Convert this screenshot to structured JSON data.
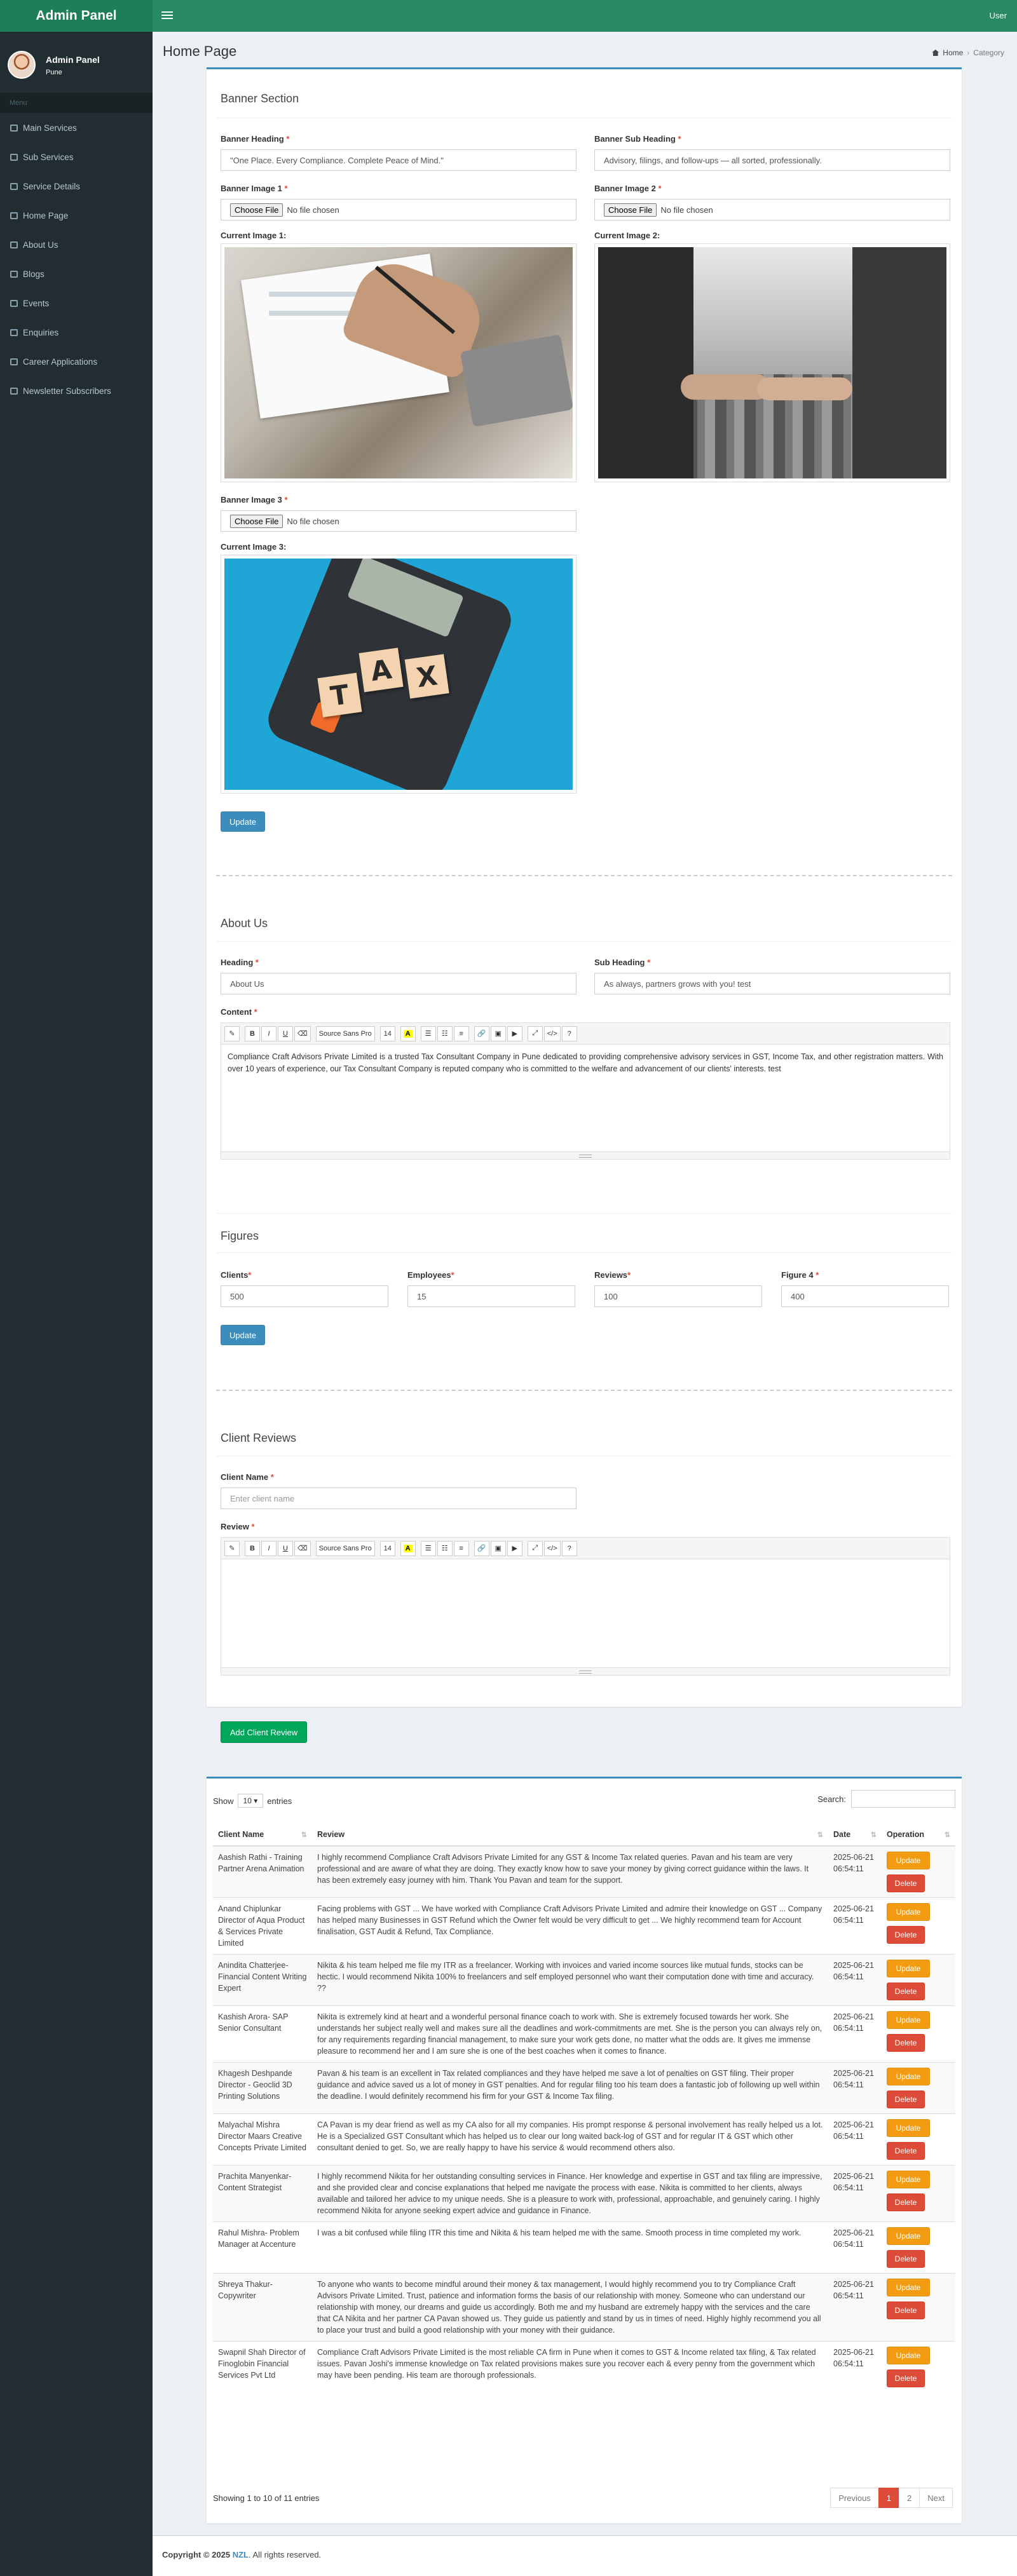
{
  "app": {
    "title": "Admin Panel",
    "user_menu": "User"
  },
  "sidebar": {
    "user_name": "Admin Panel",
    "user_location": "Pune",
    "header": "Menu",
    "items": [
      {
        "label": "Main Services"
      },
      {
        "label": "Sub Services"
      },
      {
        "label": "Service Details"
      },
      {
        "label": "Home Page"
      },
      {
        "label": "About Us"
      },
      {
        "label": "Blogs"
      },
      {
        "label": "Events"
      },
      {
        "label": "Enquiries"
      },
      {
        "label": "Career Applications"
      },
      {
        "label": "Newsletter Subscribers"
      }
    ]
  },
  "page": {
    "title": "Home Page",
    "breadcrumb": {
      "home": "Home",
      "current": "Category"
    }
  },
  "banner": {
    "section_title": "Banner Section",
    "heading_label": "Banner Heading",
    "heading_value": "\"One Place. Every Compliance. Complete Peace of Mind.\"",
    "subheading_label": "Banner Sub Heading",
    "subheading_value": "Advisory, filings, and follow-ups — all sorted, professionally.",
    "image1_label": "Banner Image 1",
    "image2_label": "Banner Image 2",
    "image3_label": "Banner Image 3",
    "current1_label": "Current Image 1:",
    "current2_label": "Current Image 2:",
    "current3_label": "Current Image 3:",
    "choose_file": "Choose File",
    "no_file": "No file chosen",
    "tax_tiles": [
      "T",
      "A",
      "X"
    ],
    "update_button": "Update"
  },
  "about": {
    "section_title": "About Us",
    "heading_label": "Heading",
    "heading_value": "About Us",
    "subheading_label": "Sub Heading",
    "subheading_value": "As always, partners grows with you! test",
    "content_label": "Content",
    "content_value": "Compliance Craft Advisors Private Limited is a trusted Tax Consultant Company in Pune dedicated to providing comprehensive advisory services in GST, Income Tax, and other registration matters. With over 10 years of experience, our Tax Consultant Company is reputed company who is committed to the welfare and advancement of our clients' interests. test"
  },
  "editor_toolbar": {
    "font": "Source Sans Pro",
    "size": "14",
    "color": "A"
  },
  "figures": {
    "section_title": "Figures",
    "fields": [
      {
        "label": "Clients",
        "value": "500"
      },
      {
        "label": "Employees",
        "value": "15"
      },
      {
        "label": "Reviews",
        "value": "100"
      },
      {
        "label": "Figure 4",
        "value": "400"
      }
    ],
    "update_button": "Update"
  },
  "client_reviews": {
    "section_title": "Client Reviews",
    "name_label": "Client Name",
    "name_placeholder": "Enter client name",
    "review_label": "Review",
    "add_button": "Add Client Review"
  },
  "table": {
    "show_label": "Show",
    "entries_value": "10",
    "entries_label": "entries",
    "search_label": "Search:",
    "columns": [
      "Client Name",
      "Review",
      "Date",
      "Operation"
    ],
    "update_label": "Update",
    "delete_label": "Delete",
    "rows": [
      {
        "name": "Aashish Rathi - Training Partner Arena Animation",
        "review": "I highly recommend Compliance Craft Advisors Private Limited for any GST & Income Tax related queries. Pavan and his team are very professional and are aware of what they are doing. They exactly know how to save your money by giving correct guidance within the laws. It has been extremely easy journey with him. Thank You Pavan and team for the support.",
        "date": "2025-06-21 06:54:11"
      },
      {
        "name": "Anand Chiplunkar Director of Aqua Product & Services Private Limited",
        "review": "Facing problems with GST ... We have worked with Compliance Craft Advisors Private Limited and admire their knowledge on GST ... Company has helped many Businesses in GST Refund which the Owner felt would be very difficult to get ... We highly recommend team for Account finalisation, GST Audit & Refund, Tax Compliance.",
        "date": "2025-06-21 06:54:11"
      },
      {
        "name": "Anindita Chatterjee- Financial Content Writing Expert",
        "review": "Nikita & his team helped me file my ITR as a freelancer. Working with invoices and varied income sources like mutual funds, stocks can be hectic. I would recommend Nikita 100% to freelancers and self employed personnel who want their computation done with time and accuracy. ??",
        "date": "2025-06-21 06:54:11"
      },
      {
        "name": "Kashish Arora- SAP Senior Consultant",
        "review": "Nikita is extremely kind at heart and a wonderful personal finance coach to work with. She is extremely focused towards her work. She understands her subject really well and makes sure all the deadlines and work-commitments are met. She is the person you can always rely on, for any requirements regarding financial management, to make sure your work gets done, no matter what the odds are. It gives me immense pleasure to recommend her and I am sure she is one of the best coaches when it comes to finance.",
        "date": "2025-06-21 06:54:11"
      },
      {
        "name": "Khagesh Deshpande Director - Geoclid 3D Printing Solutions",
        "review": "Pavan & his team is an excellent in Tax related compliances and they have helped me save a lot of penalties on GST filing. Their proper guidance and advice saved us a lot of money in GST penalties. And for regular filing too his team does a fantastic job of following up well within the deadline. I would definitely recommend his firm for your GST & Income Tax filing.",
        "date": "2025-06-21 06:54:11"
      },
      {
        "name": "Malyachal Mishra Director Maars Creative Concepts Private Limited",
        "review": "CA Pavan is my dear friend as well as my CA also for all my companies. His prompt response & personal involvement has really helped us a lot. He is a Specialized GST Consultant which has helped us to clear our long waited back-log of GST and for regular IT & GST which other consultant denied to get. So, we are really happy to have his service & would recommend others also.",
        "date": "2025-06-21 06:54:11"
      },
      {
        "name": "Prachita Manyenkar- Content Strategist",
        "review": "I highly recommend Nikita for her outstanding consulting services in Finance. Her knowledge and expertise in GST and tax filing are impressive, and she provided clear and concise explanations that helped me navigate the process with ease. Nikita is committed to her clients, always available and tailored her advice to my unique needs. She is a pleasure to work with, professional, approachable, and genuinely caring. I highly recommend Nikita for anyone seeking expert advice and guidance in Finance.",
        "date": "2025-06-21 06:54:11"
      },
      {
        "name": "Rahul Mishra- Problem Manager at Accenture",
        "review": "I was a bit confused while filing ITR this time and Nikita & his team helped me with the same. Smooth process in time completed my work.",
        "date": "2025-06-21 06:54:11"
      },
      {
        "name": "Shreya Thakur- Copywriter",
        "review": "To anyone who wants to become mindful around their money & tax management, I would highly recommend you to try Compliance Craft Advisors Private Limited. Trust, patience and information forms the basis of our relationship with money. Someone who can understand our relationship with money, our dreams and guide us accordingly. Both me and my husband are extremely happy with the services and the care that CA Nikita and her partner CA Pavan showed us. They guide us patiently and stand by us in times of need. Highly highly recommend you all to place your trust and build a good relationship with your money with their guidance.",
        "date": "2025-06-21 06:54:11"
      },
      {
        "name": "Swapnil Shah Director of Finoglobin Financial Services Pvt Ltd",
        "review": "Compliance Craft Advisors Private Limited is the most reliable CA firm in Pune when it comes to GST & Income related tax filing, & Tax related issues. Pavan Joshi's immense knowledge on Tax related provisions makes sure you recover each & every penny from the government which may have been pending. His team are thorough professionals.",
        "date": "2025-06-21 06:54:11"
      }
    ],
    "info": "Showing 1 to 10 of 11 entries",
    "pager": {
      "previous": "Previous",
      "page1": "1",
      "page2": "2",
      "next": "Next"
    }
  },
  "footer": {
    "prefix": "Copyright © 2025 ",
    "brand": "NZL",
    "suffix": ". All rights reserved."
  },
  "colors": {
    "brand": "#288a62",
    "sidebar": "#222d32",
    "primary": "#3c8dbc",
    "success": "#00a65a",
    "warning": "#f39c12",
    "danger": "#dd4b39"
  }
}
